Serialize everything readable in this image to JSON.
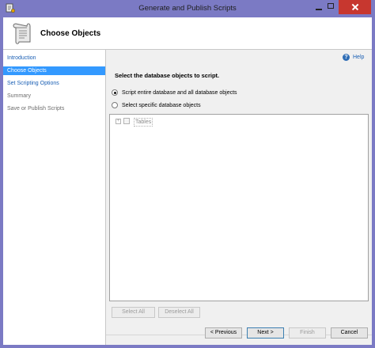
{
  "window": {
    "title": "Generate and Publish Scripts"
  },
  "header": {
    "title": "Choose Objects"
  },
  "nav": {
    "items": [
      {
        "label": "Introduction",
        "state": "link"
      },
      {
        "label": "Choose Objects",
        "state": "active"
      },
      {
        "label": "Set Scripting Options",
        "state": "link"
      },
      {
        "label": "Summary",
        "state": "disabled"
      },
      {
        "label": "Save or Publish Scripts",
        "state": "disabled"
      }
    ]
  },
  "help": {
    "label": "Help",
    "icon": "help-icon"
  },
  "main": {
    "heading": "Select the database objects to script.",
    "options": [
      {
        "label": "Script entire database and all database objects",
        "checked": true
      },
      {
        "label": "Select specific database objects",
        "checked": false
      }
    ],
    "tree": {
      "root_label": "Tables",
      "expander": "+"
    },
    "select_all_label": "Select All",
    "deselect_all_label": "Deselect All"
  },
  "footer": {
    "previous_label": "< Previous",
    "next_label": "Next >",
    "finish_label": "Finish",
    "cancel_label": "Cancel"
  },
  "colors": {
    "frame": "#7b7ac4",
    "close": "#c7372f",
    "selection": "#3399ff",
    "link": "#1a5fb4"
  }
}
